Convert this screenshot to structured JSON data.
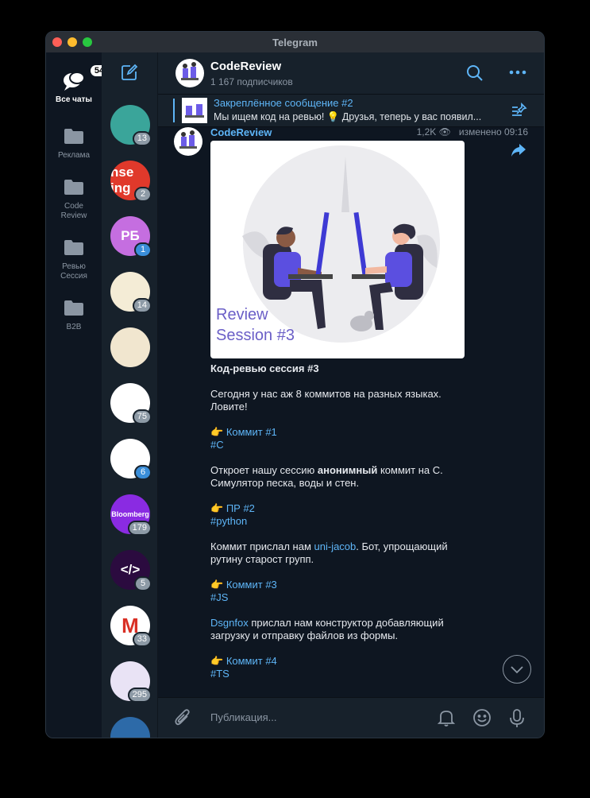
{
  "window": {
    "title": "Telegram"
  },
  "folders": [
    {
      "label": "Все чаты",
      "badge": "54",
      "icon": "chats-icon",
      "active": true
    },
    {
      "label": "Реклама",
      "icon": "folder-icon"
    },
    {
      "label": "Code Review",
      "icon": "folder-icon"
    },
    {
      "label": "Ревью Сессия",
      "icon": "folder-icon"
    },
    {
      "label": "B2B",
      "icon": "folder-icon"
    }
  ],
  "chats": [
    {
      "badge": "13",
      "text": "",
      "color": "#3aa59a"
    },
    {
      "badge": "2",
      "text": "hse ing",
      "color": "#e0392b"
    },
    {
      "badge": "1",
      "text": "РБ",
      "color": "#c56ee0"
    },
    {
      "badge": "14",
      "text": "",
      "color": "#f4ecd6"
    },
    {
      "badge": "",
      "text": "",
      "color": "#f1e6cf"
    },
    {
      "badge": "75",
      "text": "",
      "color": "#ffffff"
    },
    {
      "badge": "6",
      "text": "",
      "color": "#ffffff"
    },
    {
      "badge": "179",
      "text": "Bloomberg",
      "color": "#8a2be2"
    },
    {
      "badge": "5",
      "text": "</>",
      "color": "#2b0b3f"
    },
    {
      "badge": "33",
      "text": "M",
      "color": "#ffffff"
    },
    {
      "badge": "295",
      "text": "",
      "color": "#e9e3f5"
    },
    {
      "badge": "",
      "text": "",
      "color": "#2d6aa8"
    }
  ],
  "header": {
    "name": "CodeReview",
    "subscribers": "1 167 подписчиков"
  },
  "pinned": {
    "title": "Закреплённое сообщение #2",
    "text": "Мы ищем код на ревью! 💡  Друзья, теперь у вас появил..."
  },
  "post": {
    "author": "CodeReview",
    "views": "1,2K",
    "edited": "изменено",
    "time": "09:16",
    "image_caption_1": "Review",
    "image_caption_2": "Session #3",
    "title": "Код-ревью сессия #3",
    "intro": "Сегодня у нас аж 8 коммитов на разных языках. Ловите!",
    "c1_link": "Коммит #1",
    "c1_tag": "#C",
    "c1_text_a": "Откроет нашу сессию ",
    "c1_text_bold": "анонимный",
    "c1_text_b": " коммит на C. Симулятор песка, воды и стен.",
    "c2_link": "ПР #2",
    "c2_tag": "#python",
    "c2_text_a": "Коммит прислал нам ",
    "c2_user": "uni-jacob",
    "c2_text_b": ". Бот, упрощающий рутину старост групп.",
    "c3_link": "Коммит #3",
    "c3_tag": "#JS",
    "c3_user": "Dsgnfox",
    "c3_text_b": " прислал нам конструктор добавляющий загрузку и отправку файлов из формы.",
    "c4_link": "Коммит #4",
    "c4_tag": "#TS",
    "emoji": "👉"
  },
  "composer": {
    "placeholder": "Публикация..."
  },
  "colors": {
    "accent": "#5eb5f7",
    "bg": "#0e1621",
    "panel": "#17212b"
  }
}
